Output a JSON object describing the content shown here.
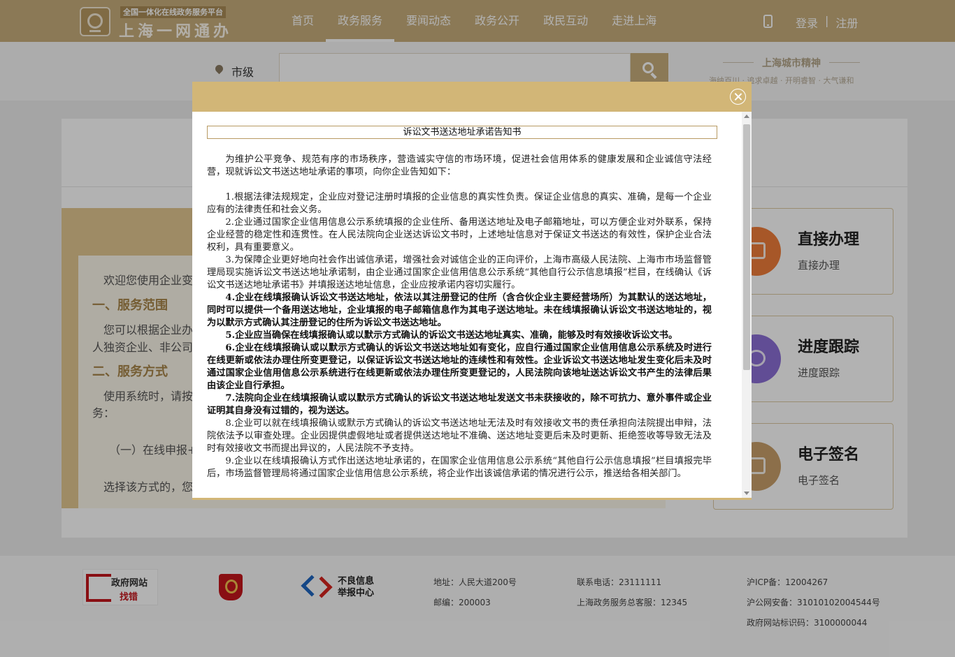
{
  "header": {
    "logo_subtitle": "全国一体化在线政务服务平台",
    "logo_title": "上海一网通办",
    "nav": [
      "首页",
      "政务服务",
      "要闻动态",
      "政务公开",
      "政民互动",
      "走进上海"
    ],
    "nav_active_index": 1,
    "login": "登录",
    "separator": "|",
    "register": "注册"
  },
  "search": {
    "region": "市级",
    "placeholder": "",
    "spirit_title": "上海城市精神",
    "spirit_words": "海纳百川 · 追求卓越 · 开明睿智 · 大气谦和"
  },
  "notice": {
    "welcome": "欢迎您使用企业变",
    "h1": "一、服务范围",
    "p1a": "您可以根据企业办",
    "p1b": "人独资企业、非公司",
    "h2": "二、服务方式",
    "p2a": "使用系统时，请按",
    "p2b": "务：",
    "p3": "（一）在线申报+寄",
    "p4": "选择该方式的，您"
  },
  "services": [
    {
      "title": "直接办理",
      "sub": "直接办理",
      "color": "#ef7d3a"
    },
    {
      "title": "进度跟踪",
      "sub": "进度跟踪",
      "color": "#8b6fd6"
    },
    {
      "title": "电子签名",
      "sub": "电子签名",
      "color": "#c9a06a"
    }
  ],
  "footer": {
    "gov_line1": "政府网站",
    "gov_line2": "找错",
    "report": "不良信息举报中心",
    "address": "地址：人民大道200号",
    "postcode": "邮编：200003",
    "phone": "联系电话：23111111",
    "service_hotline": "上海政务服务总客服：12345",
    "icp": "沪ICP备：12004267",
    "police": "沪公网安备：31010102004544号",
    "site_code": "政府网站标识码：3100000044"
  },
  "modal": {
    "title": "诉讼文书送达地址承诺告知书",
    "intro": "为维护公平竞争、规范有序的市场秩序，营造诚实守信的市场环境，促进社会信用体系的健康发展和企业诚信守法经营，现就诉讼文书送达地址承诺的事项，向你企业告知如下：",
    "items": [
      {
        "text": "1.根据法律法规规定，企业应对登记注册时填报的企业信息的真实性负责。保证企业信息的真实、准确，是每一个企业应有的法律责任和社会义务。",
        "bold": false
      },
      {
        "text": "2.企业通过国家企业信用信息公示系统填报的企业住所、备用送达地址及电子邮箱地址，可以方便企业对外联系，保持企业经营的稳定性和连贯性。在人民法院向企业送达诉讼文书时，上述地址信息对于保证文书送达的有效性，保护企业合法权利，具有重要意义。",
        "bold": false
      },
      {
        "text": "3.为保障企业更好地向社会作出诚信承诺，增强社会对诚信企业的正向评价，上海市高级人民法院、上海市市场监督管理局现实施诉讼文书送达地址承诺制，由企业通过国家企业信用信息公示系统“其他自行公示信息填报”栏目，在线确认《诉讼文书送达地址承诺书》并填报送达地址信息，企业应按承诺内容切实履行。",
        "bold": false
      },
      {
        "text": "4.企业在线填报确认诉讼文书送达地址，依法以其注册登记的住所（含合伙企业主要经营场所）为其默认的送达地址，同时可以提供一个备用送达地址，企业填报的电子邮箱信息作为其电子送达地址。未在线填报确认诉讼文书送达地址的，视为以默示方式确认其注册登记的住所为诉讼文书送达地址。",
        "bold": true
      },
      {
        "text": "5.企业应当确保在线填报确认或以默示方式确认的诉讼文书送达地址真实、准确，能够及时有效接收诉讼文书。",
        "bold": true
      },
      {
        "text": "6.企业在线填报确认或以默示方式确认的诉讼文书送达地址如有变化，应自行通过国家企业信用信息公示系统及时进行在线更新或依法办理住所变更登记，以保证诉讼文书送达地址的连续性和有效性。企业诉讼文书送达地址发生变化后未及时通过国家企业信用信息公示系统进行在线更新或依法办理住所变更登记的，人民法院向该地址送达诉讼文书产生的法律后果由该企业自行承担。",
        "bold": true
      },
      {
        "text": "7.法院向企业在线填报确认或以默示方式确认的诉讼文书送达地址发送文书未获接收的，除不可抗力、意外事件或企业证明其自身没有过错的，视为送达。",
        "bold": true
      },
      {
        "text": "8.企业可以就在线填报确认或默示方式确认的诉讼文书送达地址无法及时有效接收文书的责任承担向法院提出申辩，法院依法予以审查处理。企业因提供虚假地址或者提供送达地址不准确、送达地址变更后未及时更新、拒绝签收等导致无法及时有效接收文书而提出异议的，人民法院不予支持。",
        "bold": false
      },
      {
        "text": "9.企业以在线填报确认方式作出送达地址承诺的，在国家企业信用信息公示系统“其他自行公示信息填报”栏目填报完毕后，市场监督管理局将通过国家企业信用信息公示系统，将企业作出该诚信承诺的情况进行公示，推送给各相关部门。",
        "bold": false
      }
    ]
  }
}
